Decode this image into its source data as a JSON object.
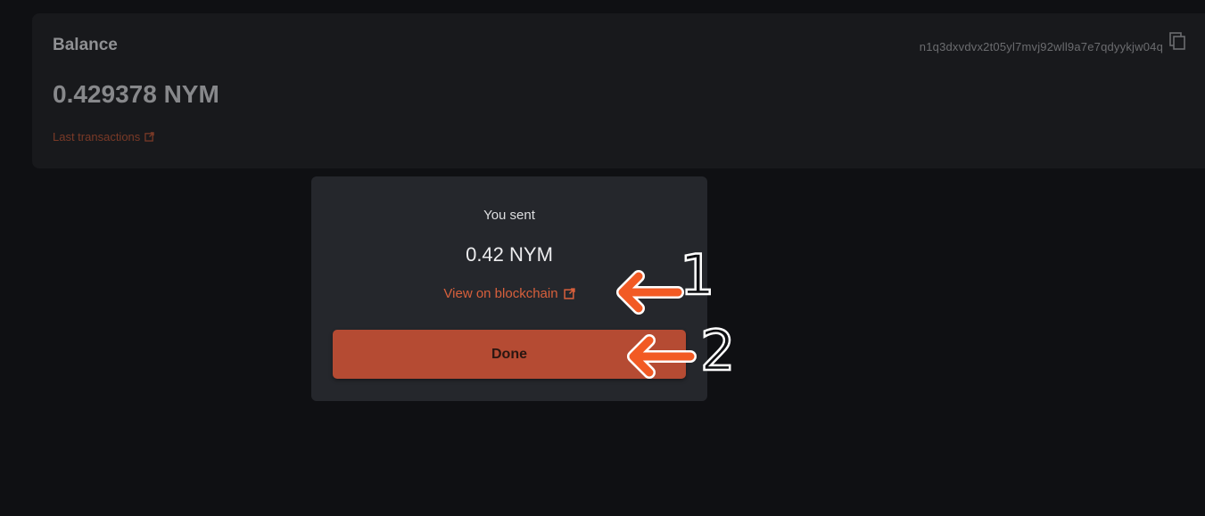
{
  "balance": {
    "title": "Balance",
    "amount": "0.429378 NYM",
    "last_transactions_label": "Last transactions",
    "address": "n1q3dxvdvx2t05yl7mvj92wll9a7e7qdyykjw04q",
    "link_icon": "external-link-icon",
    "copy_icon": "copy-icon"
  },
  "modal": {
    "label": "You sent",
    "amount": "0.42 NYM",
    "view_link_label": "View on blockchain",
    "link_icon": "external-link-icon",
    "done_label": "Done"
  },
  "annotations": {
    "arrow_color": "#f25a24",
    "marker_1": "1",
    "marker_2": "2"
  },
  "colors": {
    "accent": "#d8603c",
    "button": "#b54b33",
    "background": "#0f1013",
    "card": "#18191c",
    "modal": "#25272c"
  }
}
